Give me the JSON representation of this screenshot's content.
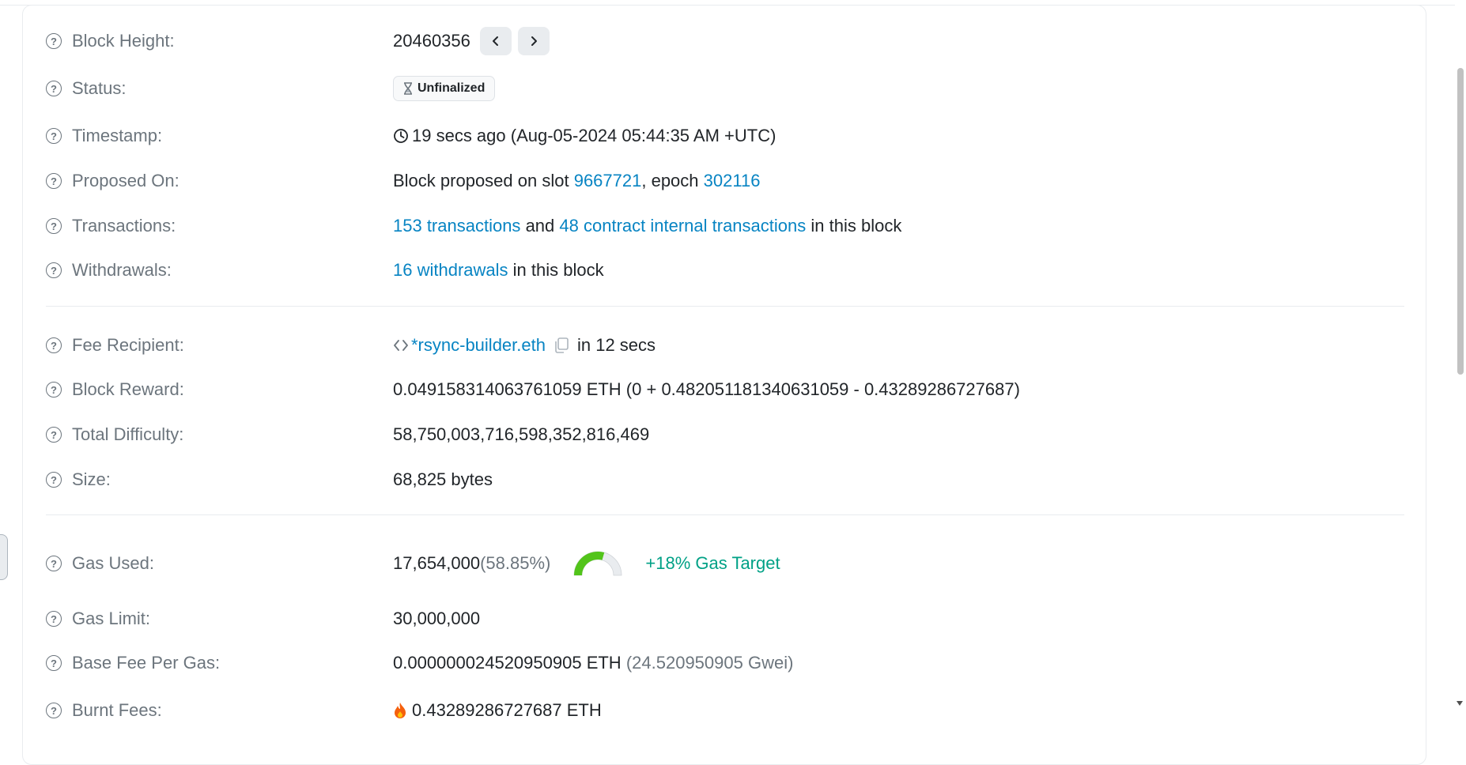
{
  "block_height": {
    "label": "Block Height:",
    "value": "20460356"
  },
  "status": {
    "label": "Status:",
    "value": "Unfinalized"
  },
  "timestamp": {
    "label": "Timestamp:",
    "value": "19 secs ago (Aug-05-2024 05:44:35 AM +UTC)"
  },
  "proposed_on": {
    "label": "Proposed On:",
    "prefix": "Block proposed on slot",
    "slot": "9667721",
    "middle": ", epoch",
    "epoch": "302116"
  },
  "transactions": {
    "label": "Transactions:",
    "tx_link": "153 transactions",
    "and": "and",
    "internal_link": "48 contract internal transactions",
    "suffix": "in this block"
  },
  "withdrawals": {
    "label": "Withdrawals:",
    "link": "16 withdrawals",
    "suffix": "in this block"
  },
  "fee_recipient": {
    "label": "Fee Recipient:",
    "name": "*rsync-builder.eth",
    "suffix": "in 12 secs"
  },
  "block_reward": {
    "label": "Block Reward:",
    "value": "0.049158314063761059 ETH (0 + 0.482051181340631059 - 0.43289286727687)"
  },
  "total_difficulty": {
    "label": "Total Difficulty:",
    "value": "58,750,003,716,598,352,816,469"
  },
  "size": {
    "label": "Size:",
    "value": "68,825 bytes"
  },
  "gas_used": {
    "label": "Gas Used:",
    "value": "17,654,000",
    "percent": "(58.85%)",
    "gauge_fraction": 0.5885,
    "target": "+18% Gas Target"
  },
  "gas_limit": {
    "label": "Gas Limit:",
    "value": "30,000,000"
  },
  "base_fee": {
    "label": "Base Fee Per Gas:",
    "value": "0.000000024520950905 ETH",
    "gwei": "(24.520950905 Gwei)"
  },
  "burnt_fees": {
    "label": "Burnt Fees:",
    "value": "0.43289286727687 ETH"
  },
  "colors": {
    "link": "#0784c3",
    "label": "#6c757d",
    "text": "#212529",
    "gauge_fill": "#52c41a",
    "gauge_track": "#e9ecef",
    "target": "#00a186",
    "flame": "#f5600d"
  },
  "icons": [
    "help-circle-icon",
    "chevron-left-icon",
    "chevron-right-icon",
    "hourglass-icon",
    "clock-icon",
    "code-icon",
    "copy-icon",
    "flame-icon"
  ]
}
